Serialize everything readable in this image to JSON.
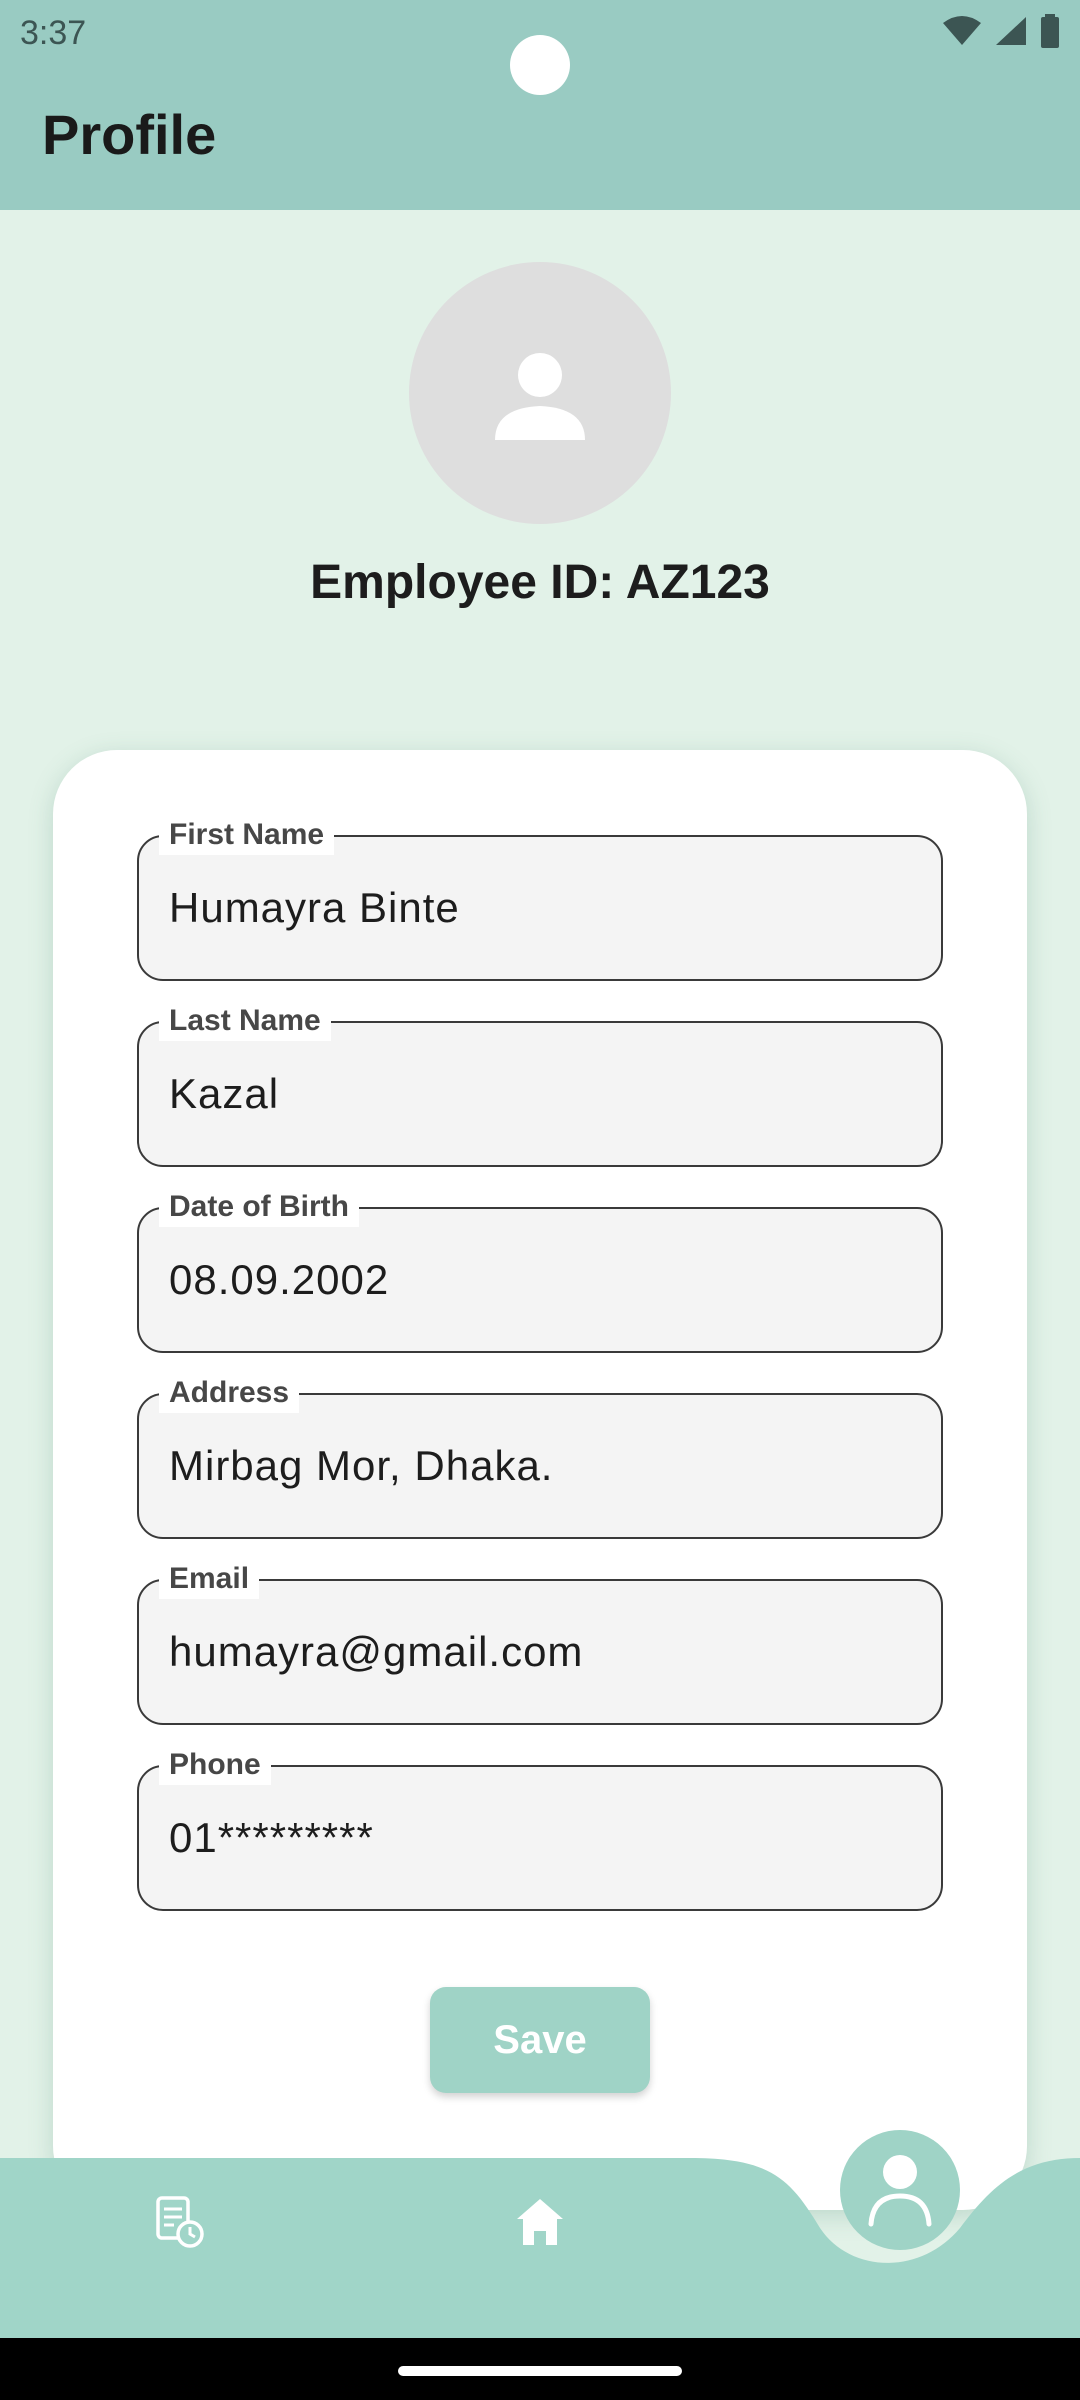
{
  "status_bar": {
    "time": "3:37",
    "icons": [
      "wifi-icon",
      "signal-icon",
      "battery-icon"
    ]
  },
  "header": {
    "title": "Profile"
  },
  "profile": {
    "avatar_icon": "person-icon",
    "employee_id": "Employee ID: AZ123"
  },
  "form": {
    "fields": [
      {
        "label": "First Name",
        "value": "Humayra Binte"
      },
      {
        "label": "Last Name",
        "value": "Kazal"
      },
      {
        "label": "Date of Birth",
        "value": "08.09.2002"
      },
      {
        "label": "Address",
        "value": "Mirbag Mor, Dhaka."
      },
      {
        "label": "Email",
        "value": "humayra@gmail.com"
      },
      {
        "label": "Phone",
        "value": "01*********"
      }
    ],
    "save_label": "Save"
  },
  "bottom_nav": {
    "items": [
      {
        "icon": "attendance-history-icon"
      },
      {
        "icon": "home-icon"
      },
      {
        "icon": "profile-icon",
        "active": true
      }
    ]
  },
  "colors": {
    "primary": "#99cbc2",
    "nav": "#a0d5c8",
    "background": "#e2f2e8",
    "button": "#9fd3c6"
  }
}
